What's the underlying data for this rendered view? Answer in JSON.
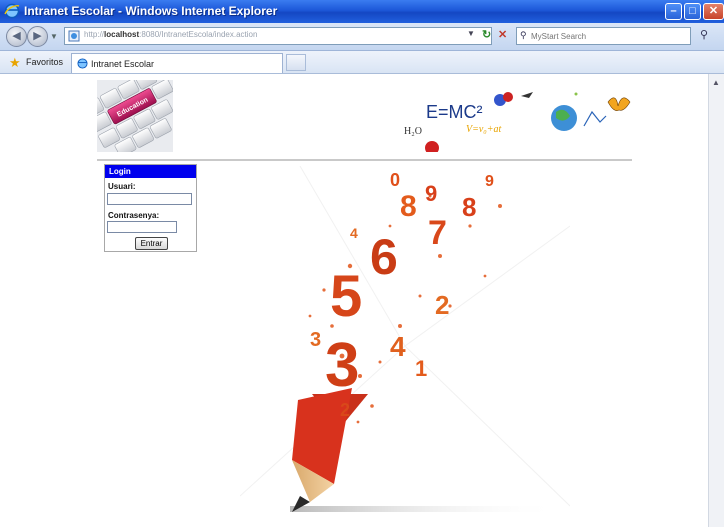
{
  "window": {
    "title": "Intranet Escolar - Windows Internet Explorer",
    "minimize_glyph": "–",
    "maximize_glyph": "□",
    "close_glyph": "✕"
  },
  "addressbar": {
    "url_prefix": "http://",
    "url_host": "localhost",
    "url_path": ":8080/IntranetEscola/index.action",
    "search_placeholder": "MyStart Search",
    "back_glyph": "◀",
    "forward_glyph": "▶",
    "refresh_glyph": "↻",
    "stop_glyph": "✕",
    "search_go_glyph": "⚲"
  },
  "favorites": {
    "label": "Favoritos",
    "tab_label": "Intranet Escolar"
  },
  "page": {
    "education_banner_text": "Education",
    "science_banner_formula": "E=MC²",
    "science_banner_h2o": "H₂O",
    "science_banner_eq": "V=v₀+at",
    "pencil_digits": [
      "0",
      "9",
      "8",
      "7",
      "6",
      "5",
      "4",
      "3",
      "2",
      "1"
    ]
  },
  "login": {
    "header": "Login",
    "user_label": "Usuari:",
    "user_value": "",
    "password_label": "Contrasenya:",
    "password_value": "",
    "submit_label": "Entrar"
  },
  "colors": {
    "title_bar": "#1c57d8",
    "login_header": "#0000ee",
    "pencil_red": "#d8321d",
    "digit_orange": "#e2551a"
  }
}
